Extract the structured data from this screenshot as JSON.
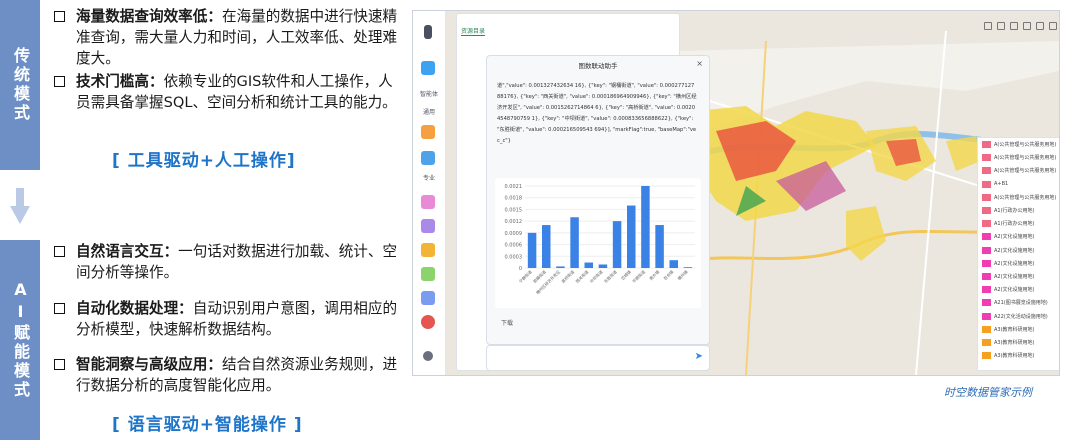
{
  "left": {
    "traditional_label": "传统模式",
    "ai_label": "AI赋能模式",
    "traditional": [
      {
        "title": "海量数据查询效率低：",
        "body": "在海量的数据中进行快速精准查询，需大量人力和时间，人工效率低、处理难度大。"
      },
      {
        "title": "技术门槛高：",
        "body": "依赖专业的GIS软件和人工操作，人员需具备掌握SQL、空间分析和统计工具的能力。"
      }
    ],
    "traditional_tag": "[ 工具驱动+人工操作]",
    "ai": [
      {
        "title": "自然语言交互：",
        "body": "一句话对数据进行加载、统计、空间分析等操作。"
      },
      {
        "title": "自动化数据处理：",
        "body": "自动识别用户意图，调用相应的分析模型，快速解析数据结构。"
      },
      {
        "title": "智能洞察与高级应用：",
        "body": "结合自然资源业务规则，进行数据分析的高度智能化应用。"
      }
    ],
    "ai_tag": "[ 语言驱动+智能操作 ]"
  },
  "screenshot": {
    "rail_labels": [
      "智能体",
      "通用",
      "专业"
    ],
    "panel_tab": "资源目录",
    "dialog_title": "图数联动助手",
    "dialog_text": "道\",\"value\": 0.001327432634 16}, {\"key\": \"钢桶街道\", \"value\": 0.00027712788176}, {\"key\": \"西关街道\", \"value\": 0.000186964909946}, {\"key\": \"横州区经济开发区\", \"value\": 0.0015262714864 6}, {\"key\": \"高桥街道\", \"value\": 0.00204548790759 1}, {\"key\": \"中坝街道\", \"value\": 0.000833656888622}, {\"key\": \"东胜街道\", \"value\": 0.000216509543 694}], \"markFlag\":true, \"baseMap\":\"vec_c\"}",
    "download": "下载",
    "send_icon": "send-icon",
    "legend": [
      {
        "label": "A(公共管理与公共服务用地)",
        "color": "#f06a86"
      },
      {
        "label": "A(公共管理与公共服务用地)",
        "color": "#f06a86"
      },
      {
        "label": "A(公共管理与公共服务用地)",
        "color": "#f06a86"
      },
      {
        "label": "A+B1",
        "color": "#f06a86"
      },
      {
        "label": "A(公共管理与公共服务用地)",
        "color": "#f06a86"
      },
      {
        "label": "A1(行政办公用地)",
        "color": "#f06a86"
      },
      {
        "label": "A1(行政办公用地)",
        "color": "#f06a86"
      },
      {
        "label": "A2(文化设施用地)",
        "color": "#f03db4"
      },
      {
        "label": "A2(文化设施用地)",
        "color": "#f03db4"
      },
      {
        "label": "A2(文化设施用地)",
        "color": "#f03db4"
      },
      {
        "label": "A2(文化设施用地)",
        "color": "#f03db4"
      },
      {
        "label": "A2(文化设施用地)",
        "color": "#f03db4"
      },
      {
        "label": "A21(图书展览设施用地)",
        "color": "#f03db4"
      },
      {
        "label": "A22(文化活动设施用地)",
        "color": "#f03db4"
      },
      {
        "label": "A3(教育科研用地)",
        "color": "#f7a020"
      },
      {
        "label": "A3(教育科研用地)",
        "color": "#f7a020"
      },
      {
        "label": "A3(教育科研用地)",
        "color": "#f7a020"
      }
    ]
  },
  "chart_data": {
    "type": "bar",
    "categories": [
      "宁静街道",
      "铜桶街道",
      "横州区经济开发区",
      "高桥街道",
      "西关街道",
      "中坝街道",
      "东胜街道",
      "峦城镇",
      "平朗街道",
      "南乡镇",
      "百合镇",
      "横州镇"
    ],
    "values": [
      0.0009,
      0.0011,
      4e-05,
      0.0013,
      0.00014,
      9e-05,
      0.0012,
      0.0016,
      0.0021,
      0.0011,
      0.0002,
      2e-05
    ],
    "yticks": [
      "0.0021",
      "0.0018",
      "0.0015",
      "0.0012",
      "0.0009",
      "0.0006",
      "0.0003",
      "0"
    ],
    "ylim": [
      0,
      0.0021
    ],
    "bar_color": "#3b82e6"
  },
  "caption": "时空数据管家示例"
}
